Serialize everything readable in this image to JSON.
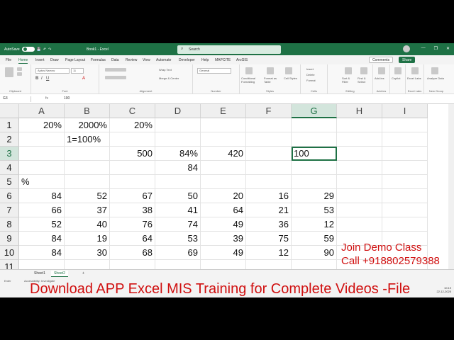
{
  "titlebar": {
    "autosave": "AutoSave",
    "doc_title": "Book1 - Excel",
    "search_placeholder": "Search",
    "minimize": "—",
    "restore": "❐",
    "close": "✕"
  },
  "menu": {
    "items": [
      "File",
      "Home",
      "Insert",
      "Draw",
      "Page Layout",
      "Formulas",
      "Data",
      "Review",
      "View",
      "Automate",
      "Developer",
      "Help",
      "MAPCITE",
      "ArcGIS"
    ],
    "active": "Home",
    "comments": "Comments",
    "share": "Share"
  },
  "ribbon": {
    "font_name": "Aptos Narrow",
    "font_size": "11",
    "number_format": "General",
    "wrap_text": "Wrap Text",
    "merge": "Merge & Center",
    "groups": [
      "Clipboard",
      "Font",
      "Alignment",
      "Number",
      "Styles",
      "Cells",
      "Editing",
      "Add-ins",
      "Excel Labs",
      "New Group"
    ],
    "style_buttons": [
      "Conditional Formatting",
      "Format as Table",
      "Cell Styles"
    ],
    "cell_buttons": [
      "Insert",
      "Delete",
      "Format"
    ],
    "editing_buttons": [
      "Sort & Filter",
      "Find & Select"
    ],
    "addin_buttons": [
      "Add-ins",
      "Copilot",
      "Excel Labs",
      "Analyze Data"
    ]
  },
  "formula_bar": {
    "name_box": "G3",
    "fx": "fx",
    "value": "100"
  },
  "grid": {
    "columns": [
      "A",
      "B",
      "C",
      "D",
      "E",
      "F",
      "G",
      "H",
      "I"
    ],
    "selected_column": "G",
    "rows": [
      "1",
      "2",
      "3",
      "4",
      "5",
      "6",
      "7",
      "8",
      "9",
      "10",
      "11"
    ],
    "selected_row": "3",
    "cells": {
      "A1": "20%",
      "B1": "2000%",
      "C1": "20%",
      "B2": "1=100%",
      "C3": "500",
      "D3": "84%",
      "E3": "420",
      "G3": "100",
      "D4": "84",
      "A5": "%",
      "A6": "84",
      "B6": "52",
      "C6": "67",
      "D6": "50",
      "E6": "20",
      "F6": "16",
      "G6": "29",
      "A7": "66",
      "B7": "37",
      "C7": "38",
      "D7": "41",
      "E7": "64",
      "F7": "21",
      "G7": "53",
      "A8": "52",
      "B8": "40",
      "C8": "76",
      "D8": "74",
      "E8": "49",
      "F8": "36",
      "G8": "12",
      "A9": "84",
      "B9": "19",
      "C9": "64",
      "D9": "53",
      "E9": "39",
      "F9": "75",
      "G9": "59",
      "A10": "84",
      "B10": "30",
      "C10": "68",
      "D10": "69",
      "E10": "49",
      "F10": "12",
      "G10": "90"
    }
  },
  "sheets": {
    "tabs": [
      "Sheet1",
      "Sheet2"
    ],
    "active": "Sheet2",
    "add": "+"
  },
  "status": {
    "mode": "Enter",
    "accessibility": "Accessibility: Investigate",
    "clock_time": "10:19",
    "clock_date": "22-12-2025"
  },
  "overlay": {
    "join": "Join Demo Class",
    "call": "Call +918802579388",
    "download": "Download APP Excel MIS Training for Complete Videos -File"
  },
  "colors": {
    "excel_green": "#1e7145",
    "overlay_red": "#d01010"
  }
}
